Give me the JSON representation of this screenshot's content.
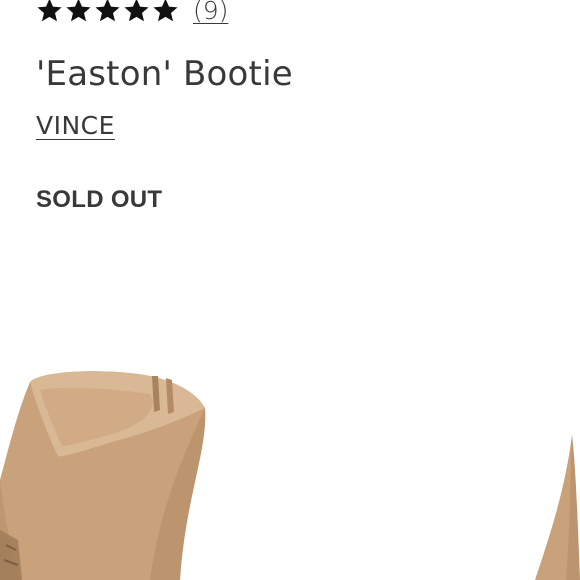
{
  "rating": {
    "stars": 5,
    "max_stars": 5,
    "review_count": "(9)"
  },
  "product": {
    "title": "'Easton' Bootie",
    "brand": "VINCE",
    "status": "SOLD OUT"
  },
  "image": {
    "icon": "ankle-bootie-photo",
    "colors": {
      "suede": "#c9a27c",
      "suede_shadow": "#b48b66",
      "lining": "#d9b896",
      "heel_wood": "#9e7a57"
    }
  },
  "colors": {
    "text": "#393939",
    "background": "#ffffff"
  }
}
